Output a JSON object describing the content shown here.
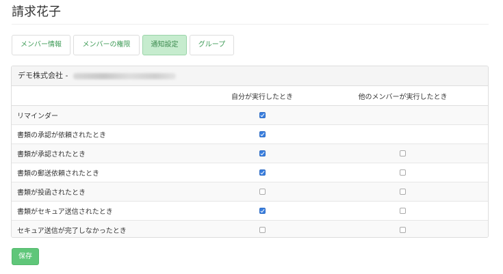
{
  "page": {
    "title": "請求花子"
  },
  "tabs": [
    {
      "label": "メンバー情報",
      "active": false
    },
    {
      "label": "メンバーの権限",
      "active": false
    },
    {
      "label": "通知設定",
      "active": true
    },
    {
      "label": "グループ",
      "active": false
    }
  ],
  "panel": {
    "company": "デモ株式会社 -",
    "columns": {
      "self": "自分が実行したとき",
      "others": "他のメンバーが実行したとき"
    },
    "rows": [
      {
        "label": "リマインダー",
        "self": true,
        "others": null
      },
      {
        "label": "書類の承認が依頼されたとき",
        "self": true,
        "others": null
      },
      {
        "label": "書類が承認されたとき",
        "self": true,
        "others": false
      },
      {
        "label": "書類の郵送依頼されたとき",
        "self": true,
        "others": false
      },
      {
        "label": "書類が投函されたとき",
        "self": false,
        "others": false
      },
      {
        "label": "書類がセキュア送信されたとき",
        "self": true,
        "others": false
      },
      {
        "label": "セキュア送信が完了しなかったとき",
        "self": false,
        "others": false
      }
    ]
  },
  "actions": {
    "save_label": "保存"
  },
  "colors": {
    "accent_green": "#5fc679",
    "tab_text": "#3c9a55",
    "active_tab_bg": "#c6ecce",
    "checkbox_checked": "#3a7fdf"
  }
}
